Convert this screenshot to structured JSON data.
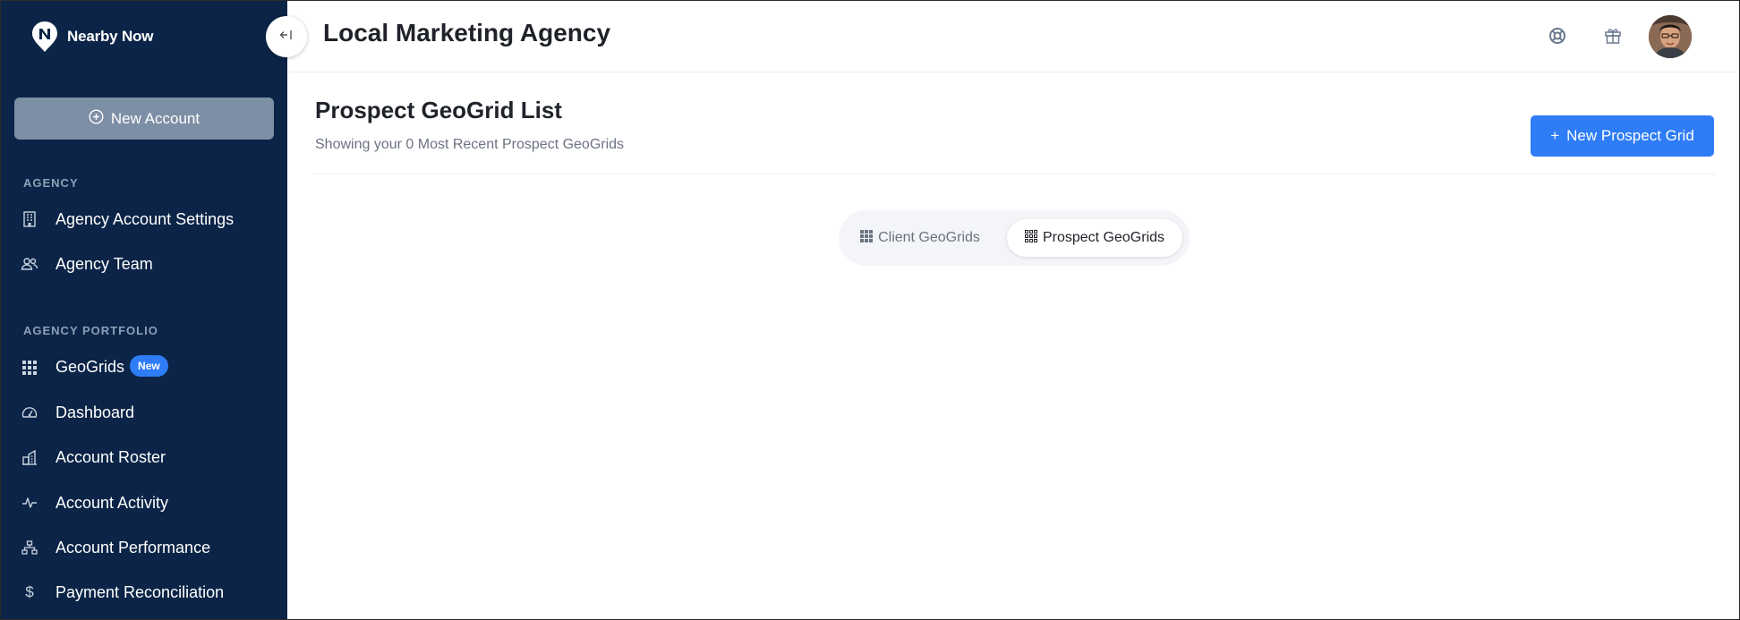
{
  "brand": {
    "name": "Nearby Now"
  },
  "sidebar": {
    "new_account_label": "New Account",
    "sections": {
      "agency": "AGENCY",
      "portfolio": "AGENCY PORTFOLIO"
    },
    "items": [
      {
        "label": "Agency Account Settings",
        "icon": "building-icon"
      },
      {
        "label": "Agency Team",
        "icon": "users-icon"
      },
      {
        "label": "GeoGrids",
        "icon": "grid-icon",
        "badge": "New"
      },
      {
        "label": "Dashboard",
        "icon": "gauge-icon"
      },
      {
        "label": "Account Roster",
        "icon": "buildings-icon"
      },
      {
        "label": "Account Activity",
        "icon": "activity-icon"
      },
      {
        "label": "Account Performance",
        "icon": "hierarchy-icon"
      },
      {
        "label": "Payment Reconciliation",
        "icon": "dollar-icon"
      }
    ]
  },
  "header": {
    "title": "Local Marketing Agency",
    "icons": [
      "help-icon",
      "gift-icon"
    ]
  },
  "main": {
    "title": "Prospect GeoGrid List",
    "subtitle": "Showing your 0 Most Recent Prospect GeoGrids",
    "new_button_label": "New Prospect Grid",
    "toggle": {
      "options": [
        "Client GeoGrids",
        "Prospect GeoGrids"
      ],
      "selected": "Prospect GeoGrids"
    }
  },
  "colors": {
    "sidebar_bg": "#0b2447",
    "accent": "#2e7cf6",
    "new_account_bg": "#7d8fa5"
  }
}
